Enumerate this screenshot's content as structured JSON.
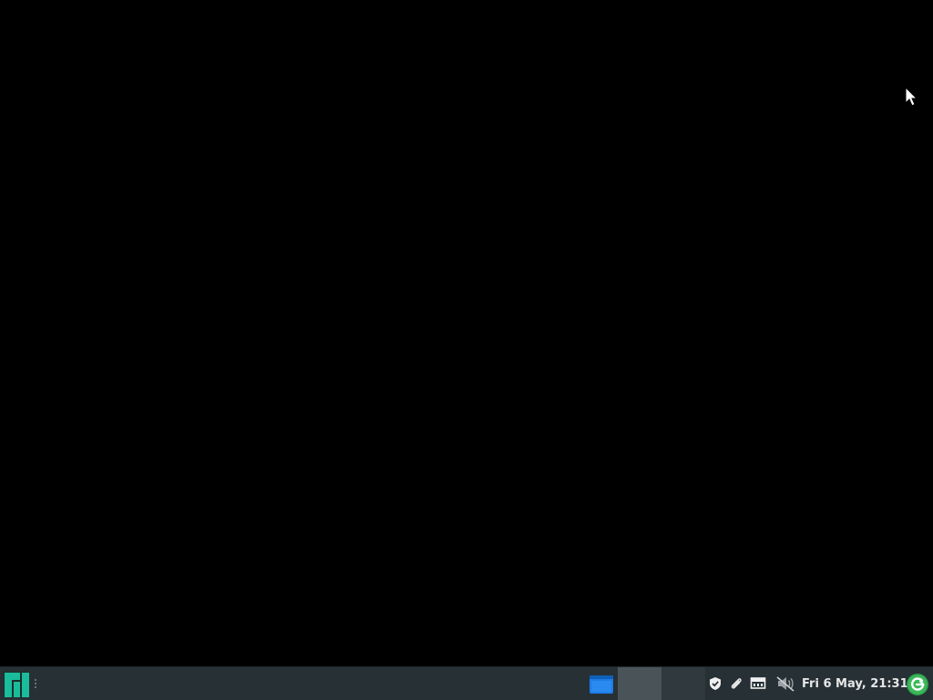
{
  "desktop": {
    "background_color": "#000000",
    "cursor_icon": "pointer-cursor-icon"
  },
  "taskbar": {
    "background_color": "#263035",
    "menu_icon": "manjaro-logo-icon",
    "handle_icon": "drag-handle-icon",
    "task_window_icon": "window-icon",
    "pager": {
      "desktops": [
        {
          "active": true,
          "color": "#4a5357"
        },
        {
          "active": false,
          "color": "#30393d"
        }
      ]
    },
    "tray": {
      "icons": [
        "shield-icon",
        "paperclip-icon",
        "network-icon",
        "volume-muted-icon"
      ]
    },
    "clock": "Fri  6 May, 21:31",
    "update_icon": "update-notifier-icon",
    "accent_color": "#1abc9c"
  }
}
